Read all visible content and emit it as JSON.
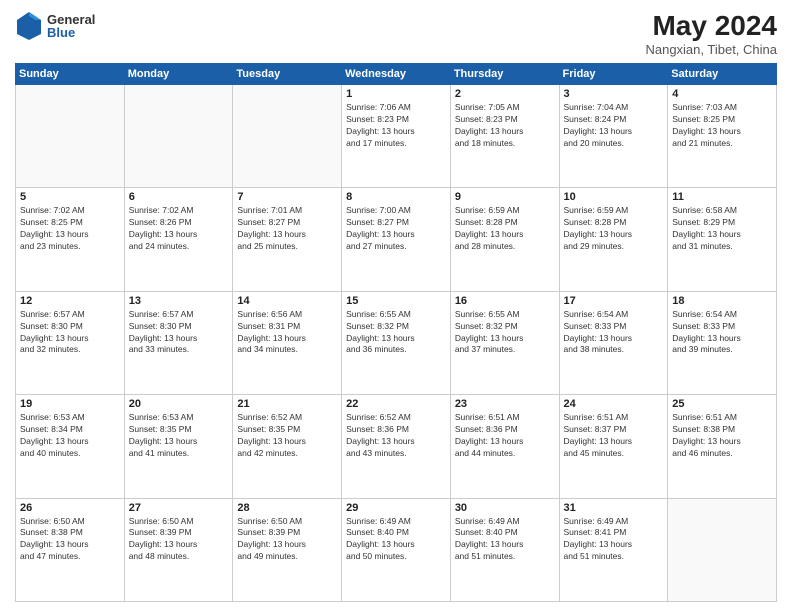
{
  "header": {
    "logo_general": "General",
    "logo_blue": "Blue",
    "month_year": "May 2024",
    "location": "Nangxian, Tibet, China"
  },
  "weekdays": [
    "Sunday",
    "Monday",
    "Tuesday",
    "Wednesday",
    "Thursday",
    "Friday",
    "Saturday"
  ],
  "weeks": [
    [
      {
        "day": "",
        "info": ""
      },
      {
        "day": "",
        "info": ""
      },
      {
        "day": "",
        "info": ""
      },
      {
        "day": "1",
        "info": "Sunrise: 7:06 AM\nSunset: 8:23 PM\nDaylight: 13 hours\nand 17 minutes."
      },
      {
        "day": "2",
        "info": "Sunrise: 7:05 AM\nSunset: 8:23 PM\nDaylight: 13 hours\nand 18 minutes."
      },
      {
        "day": "3",
        "info": "Sunrise: 7:04 AM\nSunset: 8:24 PM\nDaylight: 13 hours\nand 20 minutes."
      },
      {
        "day": "4",
        "info": "Sunrise: 7:03 AM\nSunset: 8:25 PM\nDaylight: 13 hours\nand 21 minutes."
      }
    ],
    [
      {
        "day": "5",
        "info": "Sunrise: 7:02 AM\nSunset: 8:25 PM\nDaylight: 13 hours\nand 23 minutes."
      },
      {
        "day": "6",
        "info": "Sunrise: 7:02 AM\nSunset: 8:26 PM\nDaylight: 13 hours\nand 24 minutes."
      },
      {
        "day": "7",
        "info": "Sunrise: 7:01 AM\nSunset: 8:27 PM\nDaylight: 13 hours\nand 25 minutes."
      },
      {
        "day": "8",
        "info": "Sunrise: 7:00 AM\nSunset: 8:27 PM\nDaylight: 13 hours\nand 27 minutes."
      },
      {
        "day": "9",
        "info": "Sunrise: 6:59 AM\nSunset: 8:28 PM\nDaylight: 13 hours\nand 28 minutes."
      },
      {
        "day": "10",
        "info": "Sunrise: 6:59 AM\nSunset: 8:28 PM\nDaylight: 13 hours\nand 29 minutes."
      },
      {
        "day": "11",
        "info": "Sunrise: 6:58 AM\nSunset: 8:29 PM\nDaylight: 13 hours\nand 31 minutes."
      }
    ],
    [
      {
        "day": "12",
        "info": "Sunrise: 6:57 AM\nSunset: 8:30 PM\nDaylight: 13 hours\nand 32 minutes."
      },
      {
        "day": "13",
        "info": "Sunrise: 6:57 AM\nSunset: 8:30 PM\nDaylight: 13 hours\nand 33 minutes."
      },
      {
        "day": "14",
        "info": "Sunrise: 6:56 AM\nSunset: 8:31 PM\nDaylight: 13 hours\nand 34 minutes."
      },
      {
        "day": "15",
        "info": "Sunrise: 6:55 AM\nSunset: 8:32 PM\nDaylight: 13 hours\nand 36 minutes."
      },
      {
        "day": "16",
        "info": "Sunrise: 6:55 AM\nSunset: 8:32 PM\nDaylight: 13 hours\nand 37 minutes."
      },
      {
        "day": "17",
        "info": "Sunrise: 6:54 AM\nSunset: 8:33 PM\nDaylight: 13 hours\nand 38 minutes."
      },
      {
        "day": "18",
        "info": "Sunrise: 6:54 AM\nSunset: 8:33 PM\nDaylight: 13 hours\nand 39 minutes."
      }
    ],
    [
      {
        "day": "19",
        "info": "Sunrise: 6:53 AM\nSunset: 8:34 PM\nDaylight: 13 hours\nand 40 minutes."
      },
      {
        "day": "20",
        "info": "Sunrise: 6:53 AM\nSunset: 8:35 PM\nDaylight: 13 hours\nand 41 minutes."
      },
      {
        "day": "21",
        "info": "Sunrise: 6:52 AM\nSunset: 8:35 PM\nDaylight: 13 hours\nand 42 minutes."
      },
      {
        "day": "22",
        "info": "Sunrise: 6:52 AM\nSunset: 8:36 PM\nDaylight: 13 hours\nand 43 minutes."
      },
      {
        "day": "23",
        "info": "Sunrise: 6:51 AM\nSunset: 8:36 PM\nDaylight: 13 hours\nand 44 minutes."
      },
      {
        "day": "24",
        "info": "Sunrise: 6:51 AM\nSunset: 8:37 PM\nDaylight: 13 hours\nand 45 minutes."
      },
      {
        "day": "25",
        "info": "Sunrise: 6:51 AM\nSunset: 8:38 PM\nDaylight: 13 hours\nand 46 minutes."
      }
    ],
    [
      {
        "day": "26",
        "info": "Sunrise: 6:50 AM\nSunset: 8:38 PM\nDaylight: 13 hours\nand 47 minutes."
      },
      {
        "day": "27",
        "info": "Sunrise: 6:50 AM\nSunset: 8:39 PM\nDaylight: 13 hours\nand 48 minutes."
      },
      {
        "day": "28",
        "info": "Sunrise: 6:50 AM\nSunset: 8:39 PM\nDaylight: 13 hours\nand 49 minutes."
      },
      {
        "day": "29",
        "info": "Sunrise: 6:49 AM\nSunset: 8:40 PM\nDaylight: 13 hours\nand 50 minutes."
      },
      {
        "day": "30",
        "info": "Sunrise: 6:49 AM\nSunset: 8:40 PM\nDaylight: 13 hours\nand 51 minutes."
      },
      {
        "day": "31",
        "info": "Sunrise: 6:49 AM\nSunset: 8:41 PM\nDaylight: 13 hours\nand 51 minutes."
      },
      {
        "day": "",
        "info": ""
      }
    ]
  ]
}
